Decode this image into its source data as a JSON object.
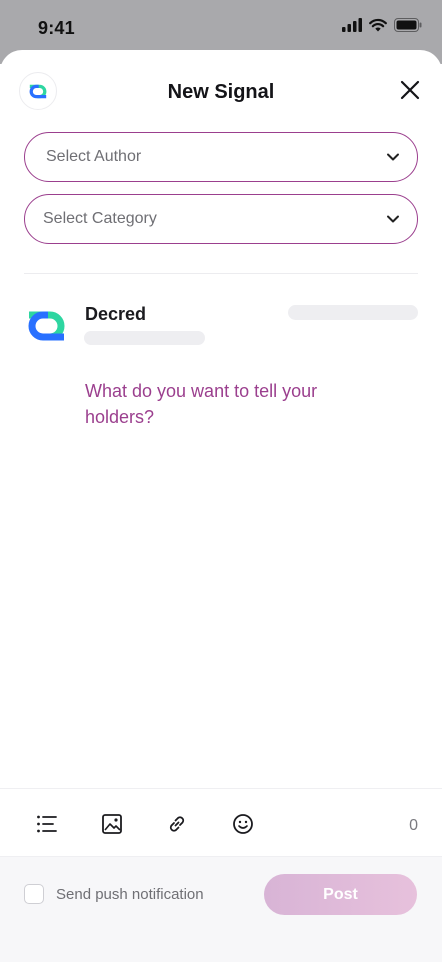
{
  "status_bar": {
    "time": "9:41"
  },
  "header": {
    "title": "New Signal"
  },
  "selects": {
    "author_placeholder": "Select Author",
    "category_placeholder": "Select Category"
  },
  "author": {
    "name": "Decred"
  },
  "compose": {
    "placeholder": "What do you want to tell your holders?"
  },
  "toolbar": {
    "char_count": "0"
  },
  "footer": {
    "push_label": "Send push notification",
    "push_checked": false,
    "post_label": "Post"
  },
  "colors": {
    "accent": "#9b3f8e",
    "post_button": "#dcb6d8",
    "brand_blue": "#2970ff",
    "brand_green": "#2ed6a1"
  }
}
